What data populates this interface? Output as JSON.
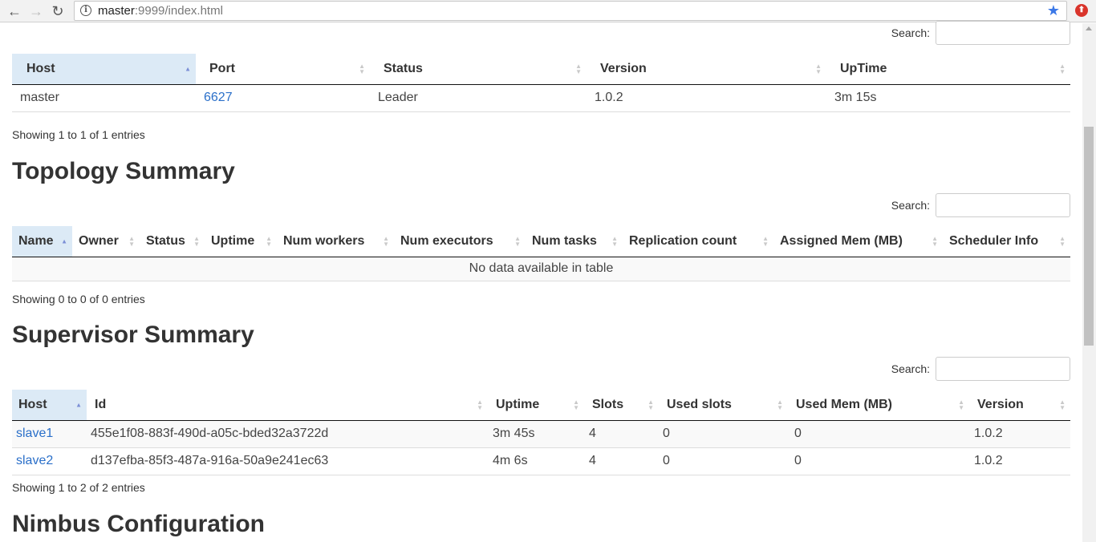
{
  "browser": {
    "url_host": "master",
    "url_rest": ":9999/index.html",
    "back_glyph": "←",
    "forward_glyph": "→",
    "reload_glyph": "↻",
    "star_glyph": "★"
  },
  "search_label": "Search:",
  "nimbus": {
    "headers": [
      "Host",
      "Port",
      "Status",
      "Version",
      "UpTime"
    ],
    "rows": [
      {
        "host": "master",
        "port": "6627",
        "status": "Leader",
        "version": "1.0.2",
        "uptime": "3m 15s"
      }
    ],
    "info": "Showing 1 to 1 of 1 entries"
  },
  "topology": {
    "title": "Topology Summary",
    "headers": [
      "Name",
      "Owner",
      "Status",
      "Uptime",
      "Num workers",
      "Num executors",
      "Num tasks",
      "Replication count",
      "Assigned Mem (MB)",
      "Scheduler Info"
    ],
    "empty": "No data available in table",
    "info": "Showing 0 to 0 of 0 entries"
  },
  "supervisor": {
    "title": "Supervisor Summary",
    "headers": [
      "Host",
      "Id",
      "Uptime",
      "Slots",
      "Used slots",
      "Used Mem (MB)",
      "Version"
    ],
    "rows": [
      {
        "host": "slave1",
        "id": "455e1f08-883f-490d-a05c-bded32a3722d",
        "uptime": "3m 45s",
        "slots": "4",
        "used_slots": "0",
        "used_mem": "0",
        "version": "1.0.2"
      },
      {
        "host": "slave2",
        "id": "d137efba-85f3-487a-916a-50a9e241ec63",
        "uptime": "4m 6s",
        "slots": "4",
        "used_slots": "0",
        "used_mem": "0",
        "version": "1.0.2"
      }
    ],
    "info": "Showing 1 to 2 of 2 entries"
  },
  "nimbus_config": {
    "title": "Nimbus Configuration"
  },
  "colors": {
    "link": "#2a6fc9",
    "sorted_header": "#dceaf6"
  }
}
